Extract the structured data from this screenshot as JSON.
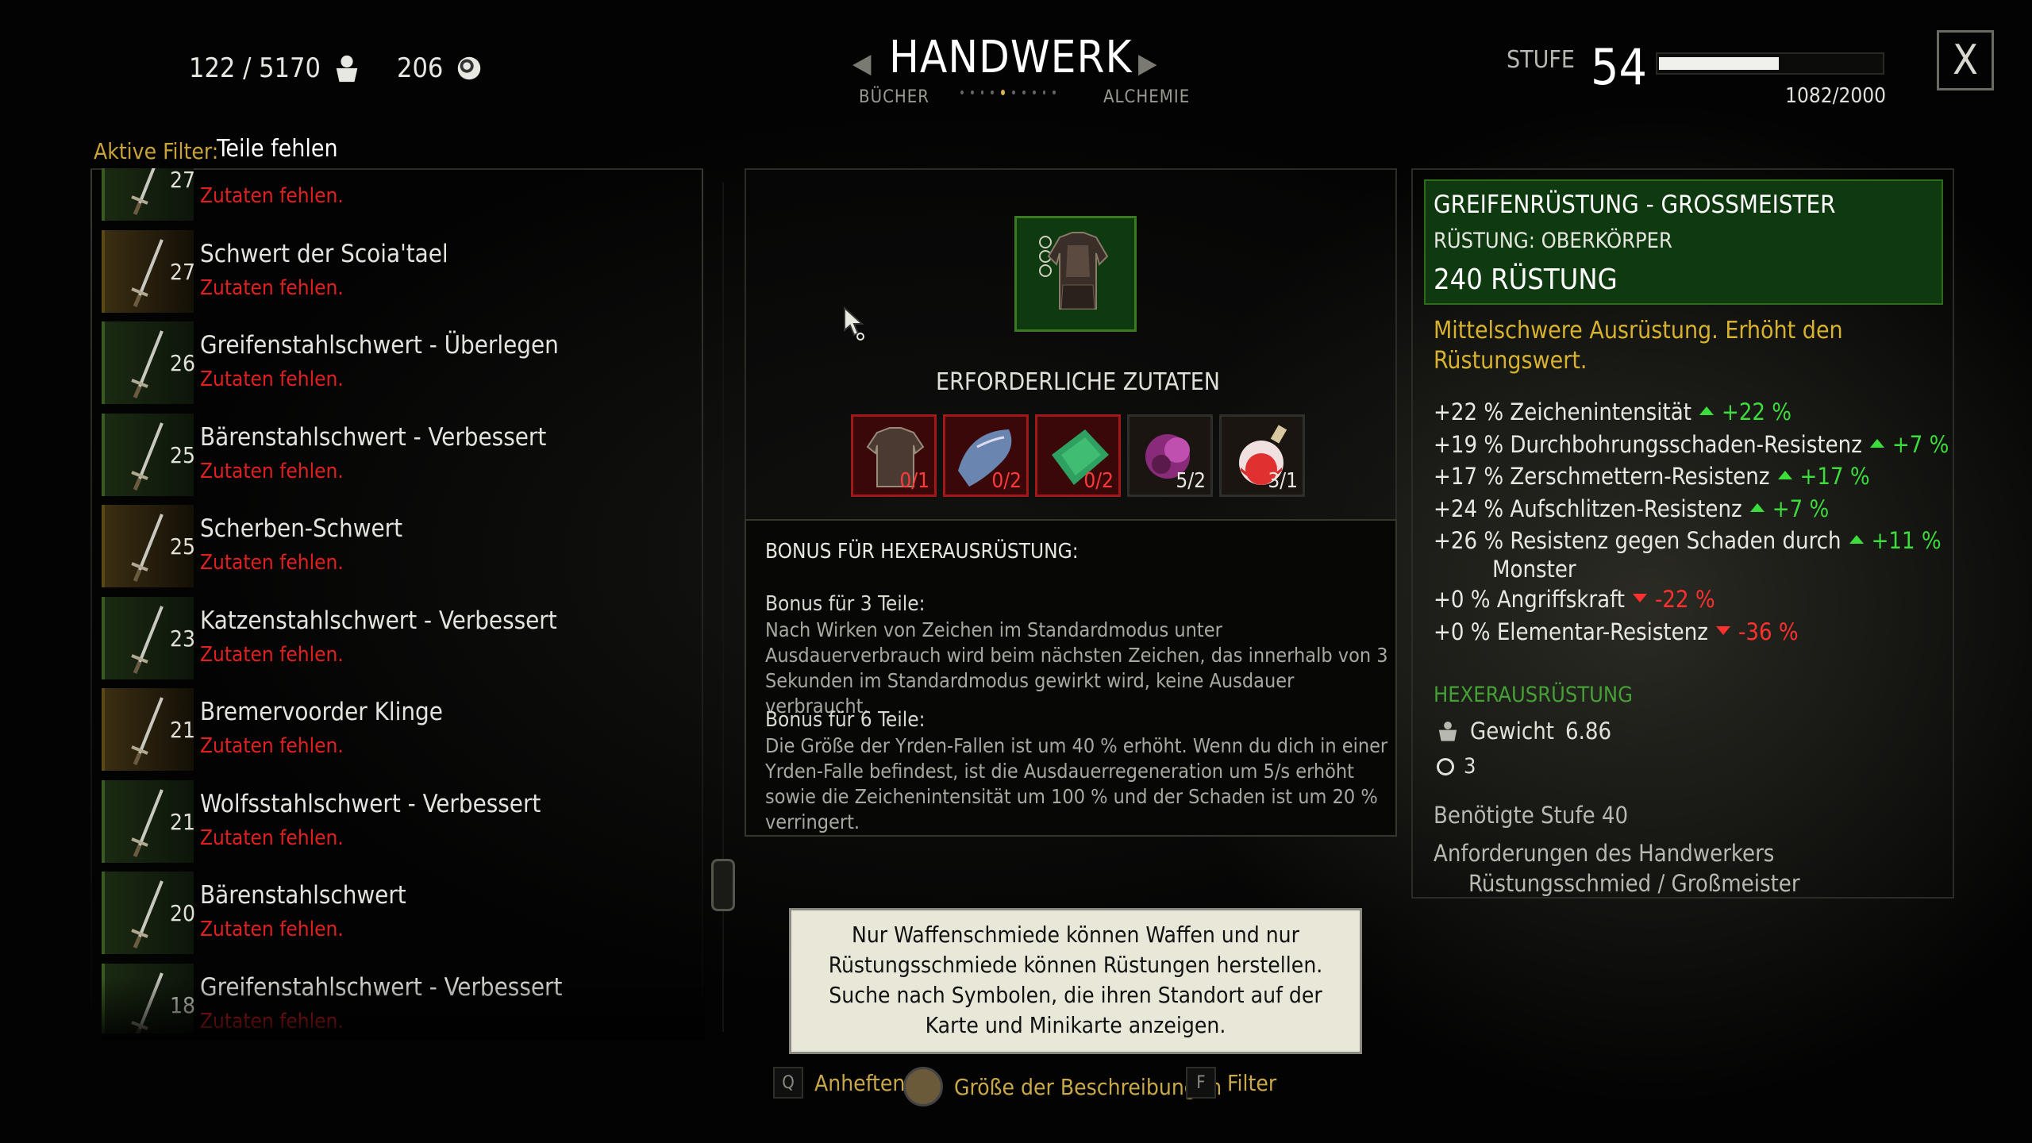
{
  "header": {
    "weight": "122 / 5170",
    "crowns": "206",
    "title": "HANDWERK",
    "prev_tab": "BÜCHER",
    "next_tab": "ALCHEMIE",
    "level_label": "STUFE",
    "level": "54",
    "xp_text": "1082/2000",
    "xp_fraction": 0.541,
    "close": "X"
  },
  "filter": {
    "label": "Aktive Filter:",
    "value": "Teile fehlen"
  },
  "list": {
    "items": [
      {
        "level": "27",
        "name": "",
        "status": "Zutaten fehlen.",
        "frame": "green"
      },
      {
        "level": "27",
        "name": "Schwert der Scoia'tael",
        "status": "Zutaten fehlen.",
        "frame": "gold"
      },
      {
        "level": "26",
        "name": "Greifenstahlschwert - Überlegen",
        "status": "Zutaten fehlen.",
        "frame": "green"
      },
      {
        "level": "25",
        "name": "Bärenstahlschwert - Verbessert",
        "status": "Zutaten fehlen.",
        "frame": "green"
      },
      {
        "level": "25",
        "name": "Scherben-Schwert",
        "status": "Zutaten fehlen.",
        "frame": "gold"
      },
      {
        "level": "23",
        "name": "Katzenstahlschwert - Verbessert",
        "status": "Zutaten fehlen.",
        "frame": "green"
      },
      {
        "level": "21",
        "name": "Bremervoorder Klinge",
        "status": "Zutaten fehlen.",
        "frame": "gold"
      },
      {
        "level": "21",
        "name": "Wolfsstahlschwert - Verbessert",
        "status": "Zutaten fehlen.",
        "frame": "green"
      },
      {
        "level": "20",
        "name": "Bärenstahlschwert",
        "status": "Zutaten fehlen.",
        "frame": "green"
      },
      {
        "level": "18",
        "name": "Greifenstahlschwert - Verbessert",
        "status": "Zutaten fehlen.",
        "frame": "green"
      }
    ]
  },
  "center": {
    "ingredients_title": "ERFORDERLICHE ZUTATEN",
    "ingredients": [
      {
        "icon": "armor-icon",
        "count": "0/1",
        "state": "missing"
      },
      {
        "icon": "griffin-trophy-icon",
        "count": "0/2",
        "state": "missing"
      },
      {
        "icon": "leather-icon",
        "count": "0/2",
        "state": "missing"
      },
      {
        "icon": "dye-icon",
        "count": "5/2",
        "state": "ok"
      },
      {
        "icon": "potion-icon",
        "count": "3/1",
        "state": "ok"
      }
    ],
    "bonus_heading": "BONUS FÜR HEXERAUSRÜSTUNG:",
    "bonus3_title": "Bonus für 3 Teile:",
    "bonus3_text": "Nach Wirken von Zeichen im Standardmodus unter Ausdauerverbrauch wird beim nächsten Zeichen, das innerhalb von 3 Sekunden im Standardmodus gewirkt wird, keine Ausdauer verbraucht.",
    "bonus6_title": "Bonus für 6 Teile:",
    "bonus6_text": "Die Größe der Yrden-Fallen ist um 40 % erhöht. Wenn du dich in einer Yrden-Falle befindest, ist die Ausdauerregeneration um 5/s erhöht sowie die Zeichenintensität um 100 % und der Schaden ist um 20 % verringert.",
    "tooltip": "Nur Waffenschmiede können Waffen und nur Rüstungsschmiede können Rüstungen herstellen. Suche nach Symbolen, die ihren Standort auf der Karte und Minikarte anzeigen."
  },
  "hints": [
    {
      "key": "Q",
      "label": "Anheften"
    },
    {
      "key": "mouse",
      "label": "Größe der Beschreibungen"
    },
    {
      "key": "F",
      "label": "Filter"
    }
  ],
  "details": {
    "name": "GREIFENRÜSTUNG - GROSSMEISTER",
    "type": "RÜSTUNG: OBERKÖRPER",
    "armor": "240 RÜSTUNG",
    "description": "Mittelschwere Ausrüstung. Erhöht den Rüstungswert.",
    "stats": [
      {
        "text": "+22 % Zeichenintensität",
        "delta": "+22 %",
        "dir": "up"
      },
      {
        "text": "+19 % Durchbohrungsschaden-Resistenz",
        "delta": "+7 %",
        "dir": "up"
      },
      {
        "text": "+17 % Zerschmettern-Resistenz",
        "delta": "+17 %",
        "dir": "up"
      },
      {
        "text": "+24 % Aufschlitzen-Resistenz",
        "delta": "+7 %",
        "dir": "up"
      },
      {
        "text": "+26 % Resistenz gegen Schaden durch",
        "text2": "Monster",
        "delta": "+11 %",
        "dir": "up"
      },
      {
        "text": "+0 % Angriffskraft",
        "delta": "-22 %",
        "dir": "down"
      },
      {
        "text": "+0 % Elementar-Resistenz",
        "delta": "-36 %",
        "dir": "down"
      }
    ],
    "category": "HEXERAUSRÜSTUNG",
    "weight_label": "Gewicht",
    "weight_value": "6.86",
    "slots": "3",
    "required_level": "Benötigte Stufe 40",
    "crafter_req": "Anforderungen des Handwerkers",
    "crafter": "Rüstungsschmied / Großmeister"
  },
  "colors": {
    "accent_gold": "#d7b22f",
    "missing_red": "#e02020",
    "up_green": "#3ddc3d",
    "panel_green": "#0f3a10"
  }
}
